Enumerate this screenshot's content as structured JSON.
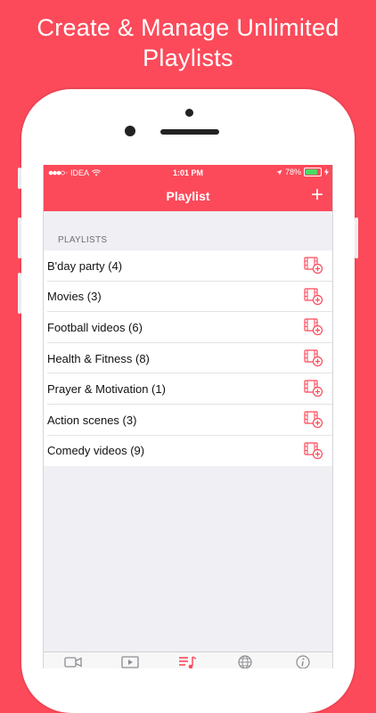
{
  "promo": {
    "headline_line1": "Create & Manage Unlimited",
    "headline_line2": "Playlists"
  },
  "status_bar": {
    "carrier": "IDEA",
    "time": "1:01 PM",
    "battery": "78%",
    "battery_level": 0.78
  },
  "nav": {
    "title": "Playlist",
    "add_icon": "plus-icon",
    "add_label": "+"
  },
  "section": {
    "header": "PLAYLISTS"
  },
  "playlists": [
    {
      "label": "B'day party (4)"
    },
    {
      "label": "Movies (3)"
    },
    {
      "label": "Football videos (6)"
    },
    {
      "label": "Health & Fitness (8)"
    },
    {
      "label": "Prayer & Motivation (1)"
    },
    {
      "label": "Action scenes (3)"
    },
    {
      "label": "Comedy videos (9)"
    }
  ],
  "row_icon": "add-video-to-playlist-icon",
  "tabs": [
    {
      "icon": "video-camera-icon",
      "active": false
    },
    {
      "icon": "play-video-icon",
      "active": false
    },
    {
      "icon": "playlist-music-icon",
      "active": true
    },
    {
      "icon": "globe-icon",
      "active": false
    },
    {
      "icon": "info-icon",
      "active": false
    }
  ],
  "colors": {
    "accent": "#fc4a5a",
    "battery": "#4cd964",
    "tab_inactive": "#8e8e93"
  }
}
